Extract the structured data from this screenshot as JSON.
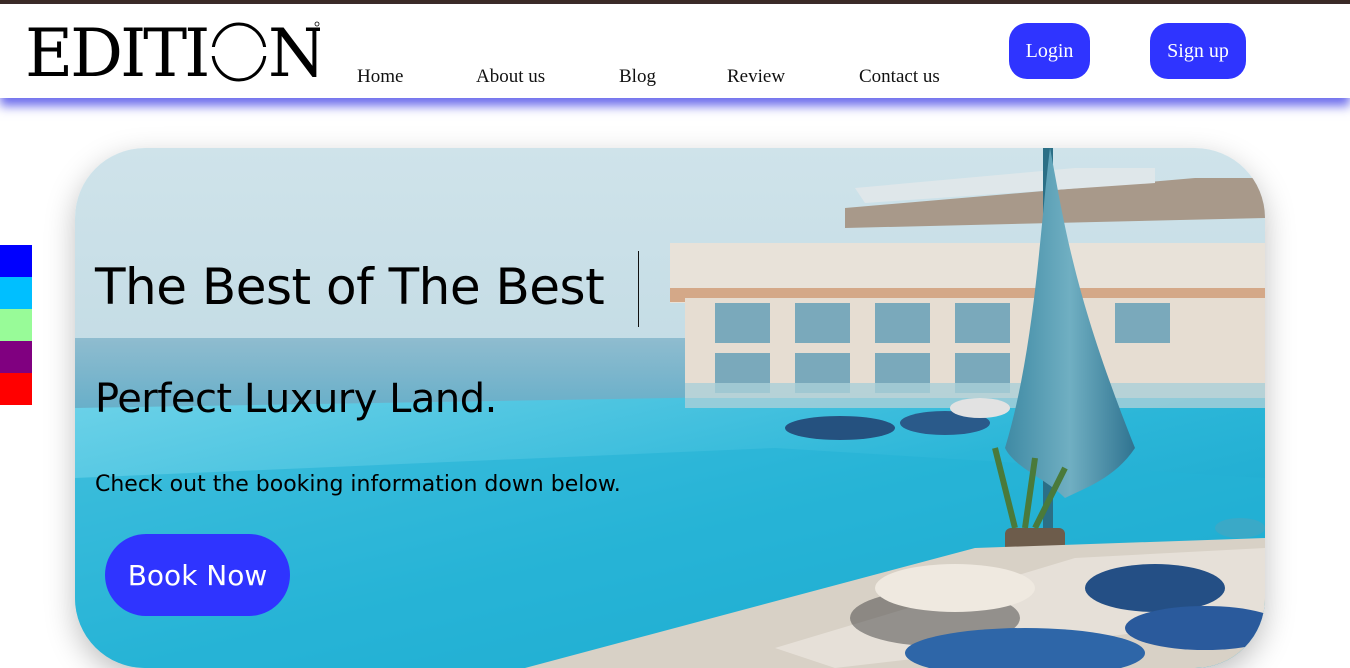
{
  "brand": {
    "logo_text": "EDITION"
  },
  "nav": {
    "links": [
      "Home",
      "About us",
      "Blog",
      "Review",
      "Contact us"
    ],
    "login_label": "Login",
    "signup_label": "Sign up"
  },
  "side_swatches": [
    "#0000ff",
    "#00bfff",
    "#98fb98",
    "#800080",
    "#ff0000"
  ],
  "hero": {
    "title": "The Best of The Best",
    "subtitle": "Perfect Luxury Land.",
    "description": "Check out the booking information down below.",
    "button_label": "Book Now"
  },
  "colors": {
    "accent": "#2f34ff",
    "top_border": "#3b2a24"
  }
}
